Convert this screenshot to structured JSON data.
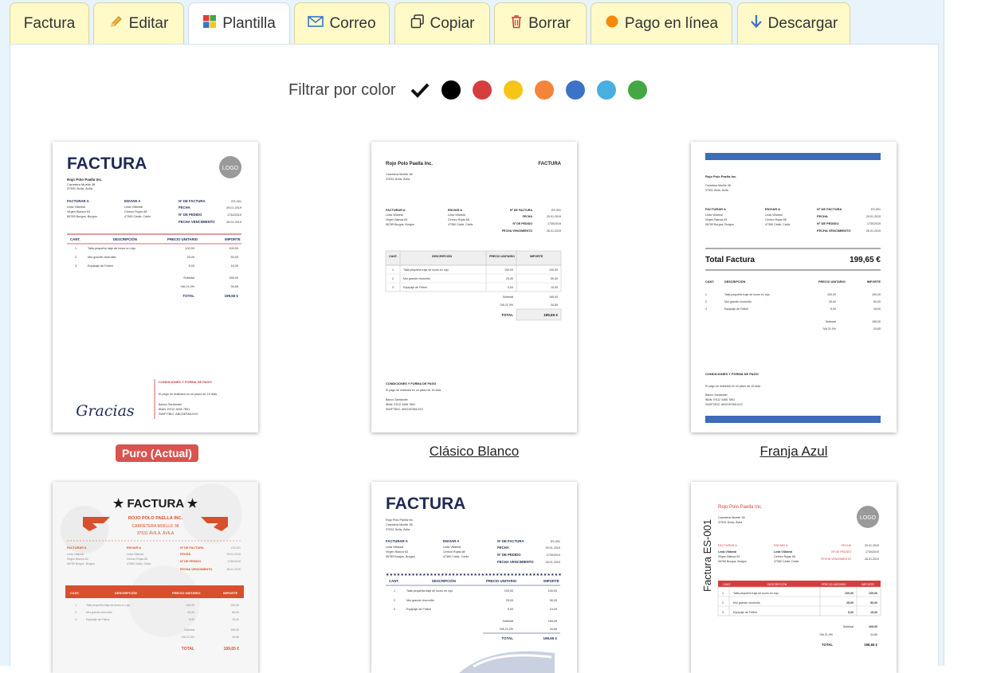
{
  "tabs": [
    {
      "label": "Factura",
      "icon": "none"
    },
    {
      "label": "Editar",
      "icon": "pencil-icon"
    },
    {
      "label": "Plantilla",
      "icon": "grid-icon"
    },
    {
      "label": "Correo",
      "icon": "envelope-icon"
    },
    {
      "label": "Copiar",
      "icon": "copy-icon"
    },
    {
      "label": "Borrar",
      "icon": "trash-icon"
    },
    {
      "label": "Pago en línea",
      "icon": "circle-icon"
    },
    {
      "label": "Descargar",
      "icon": "arrow-down-icon"
    }
  ],
  "filter": {
    "label": "Filtrar por color",
    "colors": [
      "#000000",
      "#d63e3e",
      "#f5c518",
      "#f5843a",
      "#3a73c8",
      "#4aaee0",
      "#43a843"
    ]
  },
  "templates": [
    {
      "name": "Puro (Actual)",
      "current": true
    },
    {
      "name": "Clásico Blanco",
      "current": false
    },
    {
      "name": "Franja Azul",
      "current": false
    },
    {
      "name": "",
      "current": false
    },
    {
      "name": "",
      "current": false
    },
    {
      "name": "",
      "current": false
    }
  ],
  "invoice": {
    "title": "FACTURA",
    "title_pro": "★ FACTURA ★",
    "logo": "LOGO",
    "company": "Rojo Polo Paella Inc.",
    "company_upper": "ROJO POLO PAELLA INC.",
    "street": "Carretera Muelle 38",
    "city": "37531 Ávila, Ávila",
    "street_upper": "CARRETERA MUELLE 38",
    "city_upper": "37531 ÁVILA, ÁVILA",
    "bill_to_label": "FACTURAR A",
    "ship_to_label": "ENVIAR A",
    "bill_name": "Leda Villareal",
    "bill_street": "Virgen Blanca 63",
    "bill_city": "06789 Burgos, Burgos",
    "ship_name": "Leda Villareal",
    "ship_street": "Cerezo Rojas 68",
    "ship_city": "47360 Cádiz, Cádiz",
    "num_label": "Nº DE FACTURA",
    "date_label": "FECHA",
    "order_label": "Nº DE PEDIDO",
    "due_label": "FECHA VENCIMIENTO",
    "num": "ES-001",
    "date": "29.01.2019",
    "order": "1730/2019",
    "due": "26.01.2019",
    "col_qty": "CANT.",
    "col_desc": "DESCRIPCIÓN",
    "col_price": "PRECIO UNITARIO",
    "col_amount": "IMPORTE",
    "items": [
      {
        "qty": "1",
        "desc": "Talla pequeña traje de luces en rojo",
        "price": "100,00",
        "amount": "100,00"
      },
      {
        "qty": "2",
        "desc": "Mui grande churrolito",
        "price": "25,00",
        "amount": "50,00"
      },
      {
        "qty": "3",
        "desc": "Equipaje de Fútbol",
        "price": "5,00",
        "amount": "15,00"
      }
    ],
    "subtotal_label": "Subtotal",
    "subtotal": "165,00",
    "tax_label": "IVA 21,0%",
    "tax": "34,65",
    "total_label": "TOTAL",
    "total": "199,65 €",
    "total_factura_label": "Total Factura",
    "conditions": "CONDICIONES Y FORMA DE PAGO",
    "conditions_text": "El pago se realizará en un plazo de 15 días",
    "bank": "Banco Santander",
    "iban": "IBAN: ES12 3456 7891",
    "swift": "SWIFT/BIC: ABCDESM1XXX",
    "thanks": "Gracias",
    "side_title": "Factura ES-001"
  }
}
